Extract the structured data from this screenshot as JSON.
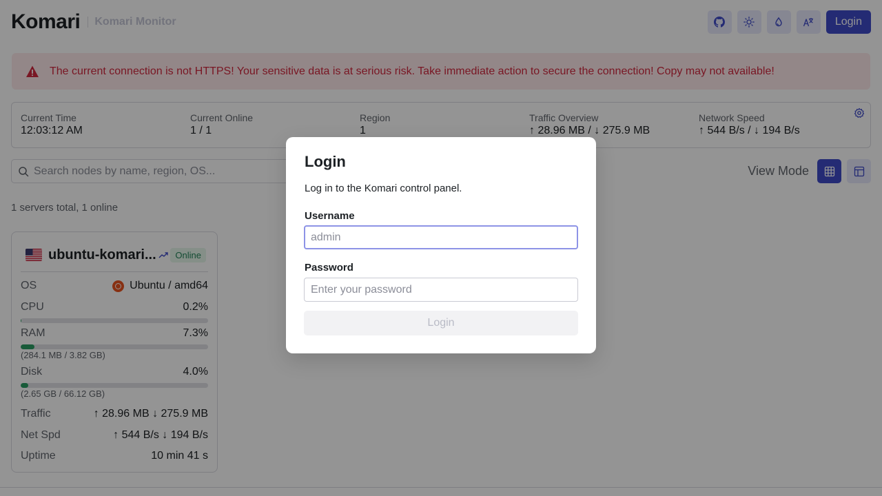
{
  "header": {
    "brand": "Komari",
    "subtitle": "Komari Monitor",
    "login_label": "Login",
    "icons": [
      "github-icon",
      "sun-icon",
      "droplet-icon",
      "translate-icon"
    ]
  },
  "alert": {
    "text": "The current connection is not HTTPS! Your sensitive data is at serious risk. Take immediate action to secure the connection! Copy may not available!",
    "color": "#d1283f"
  },
  "stats": [
    {
      "label": "Current Time",
      "value": "12:03:12 AM"
    },
    {
      "label": "Current Online",
      "value": "1 / 1"
    },
    {
      "label": "Region",
      "value": "1"
    },
    {
      "label": "Traffic Overview",
      "value": "↑ 28.96 MB / ↓ 275.9 MB"
    },
    {
      "label": "Network Speed",
      "value": "↑ 544 B/s / ↓ 194 B/s"
    }
  ],
  "search": {
    "placeholder": "Search nodes by name, region, OS..."
  },
  "view_mode": {
    "label": "View Mode",
    "active": "grid"
  },
  "summary": "1 servers total, 1 online",
  "node": {
    "name": "ubuntu-komari...",
    "status": "Online",
    "os_label": "OS",
    "os_value": "Ubuntu / amd64",
    "cpu": {
      "label": "CPU",
      "value": "0.2%",
      "fraction": 0.002
    },
    "ram": {
      "label": "RAM",
      "value": "7.3%",
      "fraction": 0.073,
      "detail": "(284.1 MB / 3.82 GB)"
    },
    "disk": {
      "label": "Disk",
      "value": "4.0%",
      "fraction": 0.04,
      "detail": "(2.65 GB / 66.12 GB)"
    },
    "traffic": {
      "label": "Traffic",
      "value": "↑ 28.96 MB ↓ 275.9 MB"
    },
    "net_speed": {
      "label": "Net Spd",
      "value": "↑ 544 B/s ↓ 194 B/s"
    },
    "uptime": {
      "label": "Uptime",
      "value": "10 min 41 s"
    }
  },
  "modal": {
    "title": "Login",
    "description": "Log in to the Komari control panel.",
    "username_label": "Username",
    "username_placeholder": "admin",
    "password_label": "Password",
    "password_placeholder": "Enter your password",
    "submit_label": "Login"
  },
  "colors": {
    "accent": "#3e4ac9",
    "online": "#218358",
    "bar_fill": "#2a9d63"
  }
}
